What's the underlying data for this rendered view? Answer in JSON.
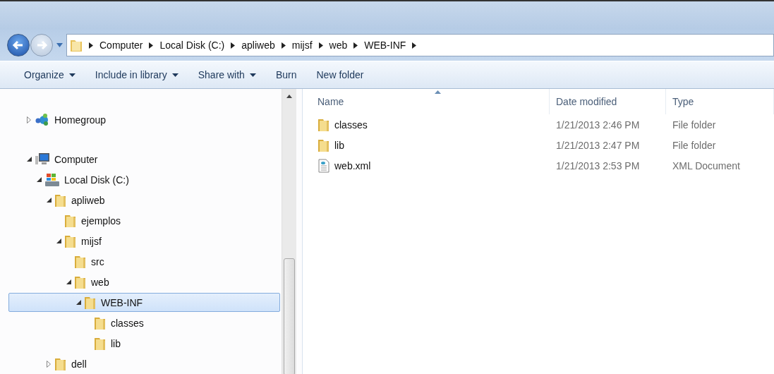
{
  "breadcrumb": [
    "Computer",
    "Local Disk (C:)",
    "apliweb",
    "mijsf",
    "web",
    "WEB-INF"
  ],
  "toolbar": [
    {
      "label": "Organize",
      "dropdown": true
    },
    {
      "label": "Include in library",
      "dropdown": true
    },
    {
      "label": "Share with",
      "dropdown": true
    },
    {
      "label": "Burn",
      "dropdown": false
    },
    {
      "label": "New folder",
      "dropdown": false
    }
  ],
  "tree": [
    {
      "label": "Homegroup",
      "kind": "homegroup",
      "expanded": false,
      "selected": false
    },
    {
      "label": "Computer",
      "kind": "computer",
      "expanded": true,
      "selected": false,
      "children": [
        {
          "label": "Local Disk (C:)",
          "kind": "disk",
          "expanded": true,
          "selected": false,
          "children": [
            {
              "label": "apliweb",
              "kind": "folder",
              "expanded": true,
              "selected": false,
              "children": [
                {
                  "label": "ejemplos",
                  "kind": "folder",
                  "selected": false
                },
                {
                  "label": "mijsf",
                  "kind": "folder",
                  "expanded": true,
                  "selected": false,
                  "children": [
                    {
                      "label": "src",
                      "kind": "folder",
                      "selected": false
                    },
                    {
                      "label": "web",
                      "kind": "folder",
                      "expanded": true,
                      "selected": false,
                      "children": [
                        {
                          "label": "WEB-INF",
                          "kind": "folder",
                          "expanded": true,
                          "selected": true,
                          "children": [
                            {
                              "label": "classes",
                              "kind": "folder",
                              "selected": false
                            },
                            {
                              "label": "lib",
                              "kind": "folder",
                              "selected": false
                            }
                          ]
                        }
                      ]
                    }
                  ]
                }
              ]
            },
            {
              "label": "dell",
              "kind": "folder",
              "expanded": false,
              "selected": false
            }
          ]
        }
      ]
    }
  ],
  "columns": [
    "Name",
    "Date modified",
    "Type"
  ],
  "files": [
    {
      "name": "classes",
      "kind": "folder",
      "date": "1/21/2013 2:46 PM",
      "type": "File folder"
    },
    {
      "name": "lib",
      "kind": "folder",
      "date": "1/21/2013 2:47 PM",
      "type": "File folder"
    },
    {
      "name": "web.xml",
      "kind": "xml",
      "date": "1/21/2013 2:53 PM",
      "type": "XML Document"
    }
  ]
}
